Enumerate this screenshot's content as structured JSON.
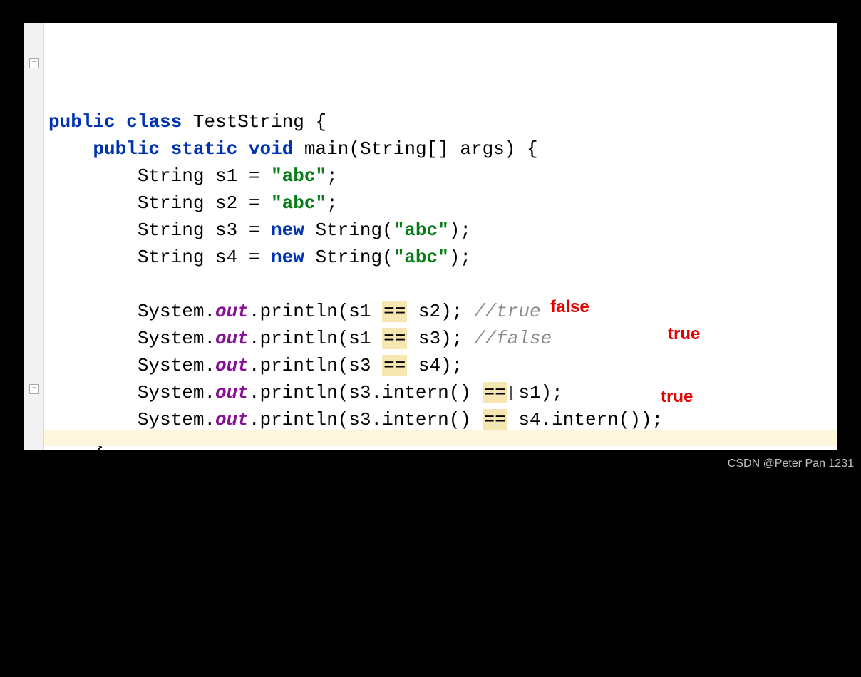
{
  "code": {
    "l1": {
      "kw1": "public",
      "kw2": "class",
      "name": "TestString",
      "brace": "{"
    },
    "l2": {
      "kw1": "public",
      "kw2": "static",
      "kw3": "void",
      "name": "main",
      "args": "(String[] args) {"
    },
    "l3": {
      "decl": "String s1 = ",
      "str": "\"abc\"",
      "semi": ";"
    },
    "l4": {
      "decl": "String s2 = ",
      "str": "\"abc\"",
      "semi": ";"
    },
    "l5": {
      "decl": "String s3 = ",
      "kw": "new",
      "call": " String(",
      "str": "\"abc\"",
      "end": ");"
    },
    "l6": {
      "decl": "String s4 = ",
      "kw": "new",
      "call": " String(",
      "str": "\"abc\"",
      "end": ");"
    },
    "l8": {
      "pre": "System.",
      "field": "out",
      "mid1": ".println(s1 ",
      "op": "==",
      "mid2": " s2); ",
      "comment": "//true"
    },
    "l9": {
      "pre": "System.",
      "field": "out",
      "mid1": ".println(s1 ",
      "op": "==",
      "mid2": " s3); ",
      "comment": "//false"
    },
    "l10": {
      "pre": "System.",
      "field": "out",
      "mid1": ".println(s3 ",
      "op": "==",
      "mid2": " s4);"
    },
    "l11": {
      "pre": "System.",
      "field": "out",
      "mid1": ".println(s3.intern() ",
      "op": "==",
      "mid2": " s1);"
    },
    "l12": {
      "pre": "System.",
      "field": "out",
      "mid1": ".println(s3.intern() ",
      "op": "==",
      "mid2": " s4.intern());"
    },
    "l13": {
      "brace": "}"
    },
    "l14": {
      "brace": "}"
    }
  },
  "annotations": {
    "ann1": "false",
    "ann2": "true",
    "ann3": "true"
  },
  "watermark": "CSDN @Peter Pan 1231"
}
